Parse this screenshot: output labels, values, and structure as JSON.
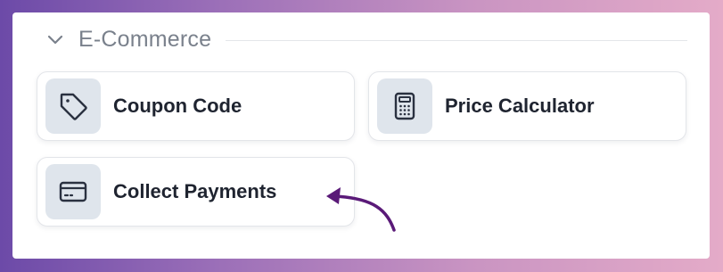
{
  "section": {
    "title": "E-Commerce",
    "collapse_icon": "chevron-down-icon"
  },
  "cards": [
    {
      "label": "Coupon Code",
      "icon": "tag-icon"
    },
    {
      "label": "Price Calculator",
      "icon": "calculator-icon"
    },
    {
      "label": "Collect Payments",
      "icon": "credit-card-icon"
    }
  ],
  "annotation": {
    "icon": "curved-arrow-icon",
    "color": "#5a1a78"
  },
  "colors": {
    "icon_tile": "#dfe5ec",
    "icon_stroke": "#2a3140",
    "label": "#1f2430",
    "section_title": "#7a818c"
  }
}
